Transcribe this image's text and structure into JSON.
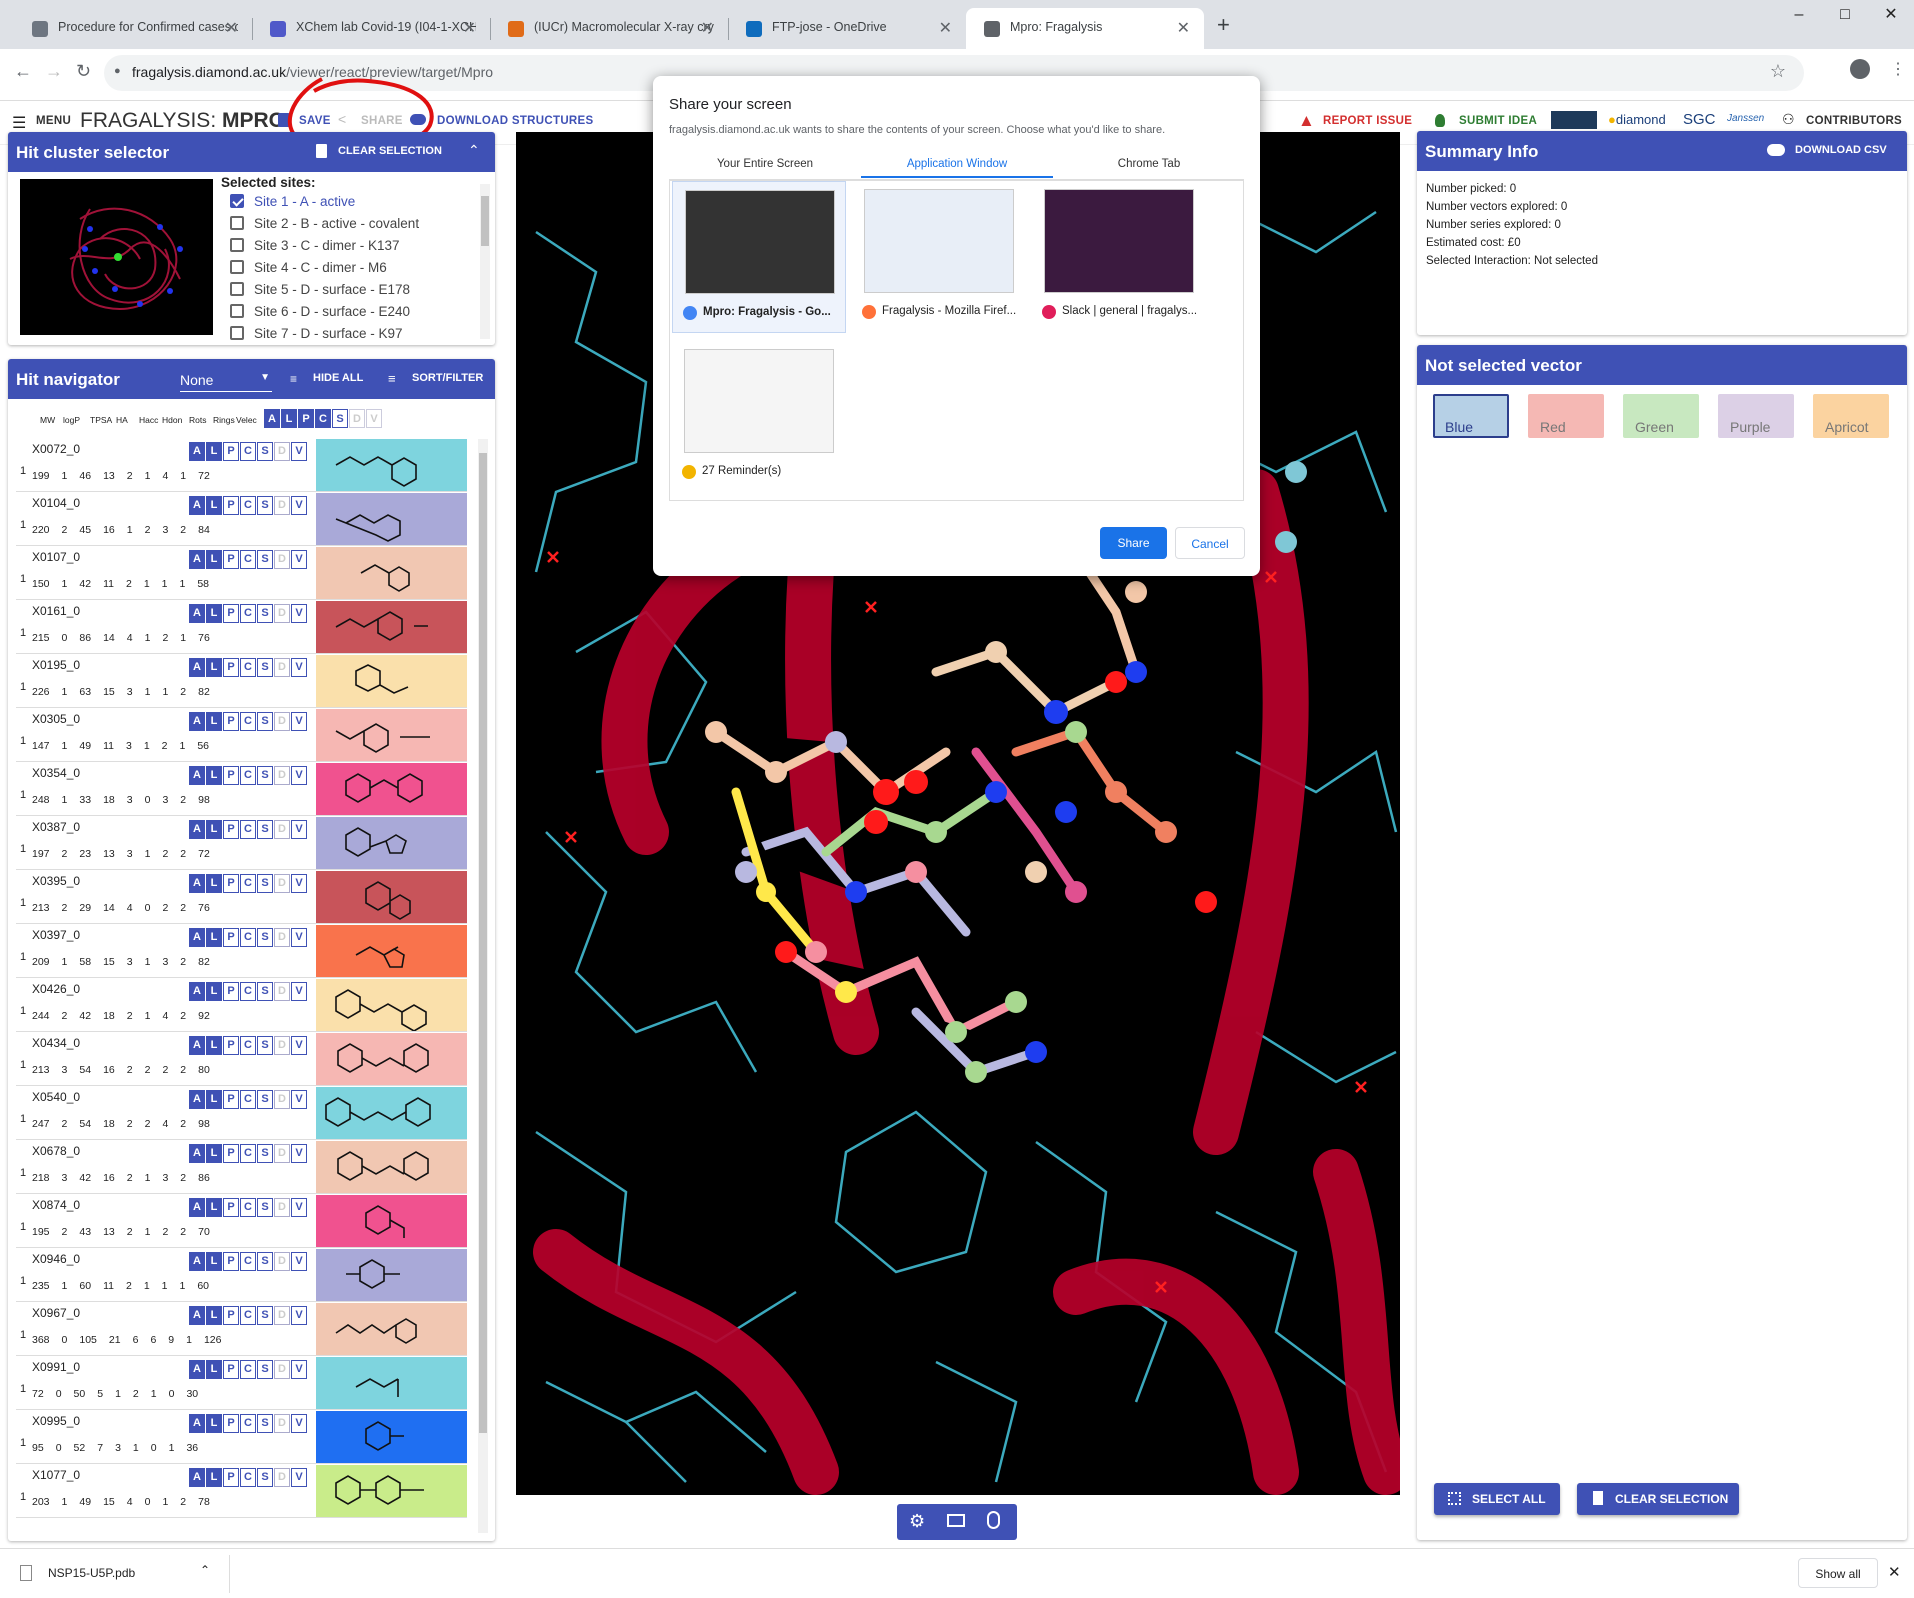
{
  "browser": {
    "tabs": [
      {
        "label": "Procedure for Confirmed cases o",
        "icon": "people-icon",
        "color": "#6e7681"
      },
      {
        "label": "XChem lab Covid-19 (I04-1-XCH",
        "icon": "teams-icon",
        "color": "#5059c9"
      },
      {
        "label": "(IUCr) Macromolecular X-ray cry",
        "icon": "iucr-icon",
        "color": "#e06b18"
      },
      {
        "label": "FTP-jose - OneDrive",
        "icon": "onedrive-icon",
        "color": "#0f6cbd"
      },
      {
        "label": "Mpro: Fragalysis",
        "icon": "globe-icon",
        "color": "#5f6368"
      }
    ],
    "url_host": "fragalysis.diamond.ac.uk",
    "url_path": "/viewer/react/preview/target/Mpro"
  },
  "app": {
    "menu": "MENU",
    "title_prefix": "FRAGALYSIS: ",
    "title_target": "MPRO",
    "save": "SAVE",
    "share": "SHARE",
    "download_structures": "DOWNLOAD STRUCTURES",
    "report_issue": "REPORT ISSUE",
    "submit_idea": "SUBMIT IDEA",
    "contributors": "CONTRIBUTORS",
    "logos": [
      "diamond",
      "SGC",
      "Janssen"
    ],
    "accent": "#3f51b5"
  },
  "cluster": {
    "title": "Hit cluster selector",
    "clear": "CLEAR SELECTION",
    "selected_label": "Selected sites:",
    "sites": [
      {
        "label": "Site 1 - A - active",
        "checked": true
      },
      {
        "label": "Site 2 - B - active - covalent",
        "checked": false
      },
      {
        "label": "Site 3 - C - dimer - K137",
        "checked": false
      },
      {
        "label": "Site 4 - C - dimer - M6",
        "checked": false
      },
      {
        "label": "Site 5 - D - surface - E178",
        "checked": false
      },
      {
        "label": "Site 6 - D - surface - E240",
        "checked": false
      },
      {
        "label": "Site 7 - D - surface - K97",
        "checked": false
      }
    ]
  },
  "navigator": {
    "title": "Hit navigator",
    "dropdown": "None",
    "hide_all": "HIDE ALL",
    "sort_filter": "SORT/FILTER",
    "columns": [
      "MW",
      "logP",
      "TPSA",
      "HA",
      "Hacc",
      "Hdon",
      "Rots",
      "Rings",
      "Velec"
    ],
    "toggle_labels": [
      "A",
      "L",
      "P",
      "C",
      "S",
      "D",
      "V"
    ],
    "rows": [
      {
        "code": "X0072_0",
        "props": [
          "199",
          "1",
          "46",
          "13",
          "2",
          "1",
          "4",
          "1",
          "72"
        ],
        "bg": "#7ed4de"
      },
      {
        "code": "X0104_0",
        "props": [
          "220",
          "2",
          "45",
          "16",
          "1",
          "2",
          "3",
          "2",
          "84"
        ],
        "bg": "#a9a9d8"
      },
      {
        "code": "X0107_0",
        "props": [
          "150",
          "1",
          "42",
          "11",
          "2",
          "1",
          "1",
          "1",
          "58"
        ],
        "bg": "#f1c7b2"
      },
      {
        "code": "X0161_0",
        "props": [
          "215",
          "0",
          "86",
          "14",
          "4",
          "1",
          "2",
          "1",
          "76"
        ],
        "bg": "#c8545a"
      },
      {
        "code": "X0195_0",
        "props": [
          "226",
          "1",
          "63",
          "15",
          "3",
          "1",
          "1",
          "2",
          "82"
        ],
        "bg": "#fae0ab"
      },
      {
        "code": "X0305_0",
        "props": [
          "147",
          "1",
          "49",
          "11",
          "3",
          "1",
          "2",
          "1",
          "56"
        ],
        "bg": "#f6b7b3"
      },
      {
        "code": "X0354_0",
        "props": [
          "248",
          "1",
          "33",
          "18",
          "3",
          "0",
          "3",
          "2",
          "98"
        ],
        "bg": "#f0528f"
      },
      {
        "code": "X0387_0",
        "props": [
          "197",
          "2",
          "23",
          "13",
          "3",
          "1",
          "2",
          "2",
          "72"
        ],
        "bg": "#a9a9d8"
      },
      {
        "code": "X0395_0",
        "props": [
          "213",
          "2",
          "29",
          "14",
          "4",
          "0",
          "2",
          "2",
          "76"
        ],
        "bg": "#c8545a"
      },
      {
        "code": "X0397_0",
        "props": [
          "209",
          "1",
          "58",
          "15",
          "3",
          "1",
          "3",
          "2",
          "82"
        ],
        "bg": "#f9734c"
      },
      {
        "code": "X0426_0",
        "props": [
          "244",
          "2",
          "42",
          "18",
          "2",
          "1",
          "4",
          "2",
          "92"
        ],
        "bg": "#fae0ab"
      },
      {
        "code": "X0434_0",
        "props": [
          "213",
          "3",
          "54",
          "16",
          "2",
          "2",
          "2",
          "2",
          "80"
        ],
        "bg": "#f6b7b3"
      },
      {
        "code": "X0540_0",
        "props": [
          "247",
          "2",
          "54",
          "18",
          "2",
          "2",
          "4",
          "2",
          "98"
        ],
        "bg": "#7ed4de"
      },
      {
        "code": "X0678_0",
        "props": [
          "218",
          "3",
          "42",
          "16",
          "2",
          "1",
          "3",
          "2",
          "86"
        ],
        "bg": "#f1c7b2"
      },
      {
        "code": "X0874_0",
        "props": [
          "195",
          "2",
          "43",
          "13",
          "2",
          "1",
          "2",
          "2",
          "70"
        ],
        "bg": "#f0528f"
      },
      {
        "code": "X0946_0",
        "props": [
          "235",
          "1",
          "60",
          "11",
          "2",
          "1",
          "1",
          "1",
          "60"
        ],
        "bg": "#a9a9d8"
      },
      {
        "code": "X0967_0",
        "props": [
          "368",
          "0",
          "105",
          "21",
          "6",
          "6",
          "9",
          "1",
          "126"
        ],
        "bg": "#f1c7b2"
      },
      {
        "code": "X0991_0",
        "props": [
          "72",
          "0",
          "50",
          "5",
          "1",
          "2",
          "1",
          "0",
          "30"
        ],
        "bg": "#7ed4de"
      },
      {
        "code": "X0995_0",
        "props": [
          "95",
          "0",
          "52",
          "7",
          "3",
          "1",
          "0",
          "1",
          "36"
        ],
        "bg": "#1f6ff2"
      },
      {
        "code": "X1077_0",
        "props": [
          "203",
          "1",
          "49",
          "15",
          "4",
          "0",
          "1",
          "2",
          "78"
        ],
        "bg": "#c9ec8a"
      }
    ]
  },
  "share_dialog": {
    "title": "Share your screen",
    "subtitle": "fragalysis.diamond.ac.uk wants to share the contents of your screen. Choose what you'd like to share.",
    "tabs": [
      "Your Entire Screen",
      "Application Window",
      "Chrome Tab"
    ],
    "active_tab": "Application Window",
    "windows": [
      {
        "label": "Mpro: Fragalysis - Go...",
        "icon": "chrome-icon"
      },
      {
        "label": "Fragalysis - Mozilla Firef...",
        "icon": "firefox-icon"
      },
      {
        "label": "Slack | general | fragalys...",
        "icon": "slack-icon"
      },
      {
        "label": "27 Reminder(s)",
        "icon": "bell-icon"
      }
    ],
    "share": "Share",
    "cancel": "Cancel"
  },
  "summary": {
    "title": "Summary Info",
    "download_csv": "DOWNLOAD CSV",
    "lines": [
      "Number picked: 0",
      "Number vectors explored: 0",
      "Number series explored: 0",
      "Estimated cost: £0",
      "Selected Interaction: Not selected"
    ]
  },
  "vectors": {
    "title": "Not selected vector",
    "buttons": [
      {
        "label": "Blue",
        "bg": "#b6d0e6",
        "border": "#2c3e8c"
      },
      {
        "label": "Red",
        "bg": "#f5b8b4",
        "border": "#f5b8b4"
      },
      {
        "label": "Green",
        "bg": "#c8e8c0",
        "border": "#c8e8c0"
      },
      {
        "label": "Purple",
        "bg": "#dcd0e6",
        "border": "#dcd0e6"
      },
      {
        "label": "Apricot",
        "bg": "#fbd3a0",
        "border": "#fbd3a0"
      }
    ],
    "select_all": "SELECT ALL",
    "clear_selection": "CLEAR SELECTION"
  },
  "downloads": {
    "file": "NSP15-U5P.pdb",
    "show_all": "Show all"
  }
}
